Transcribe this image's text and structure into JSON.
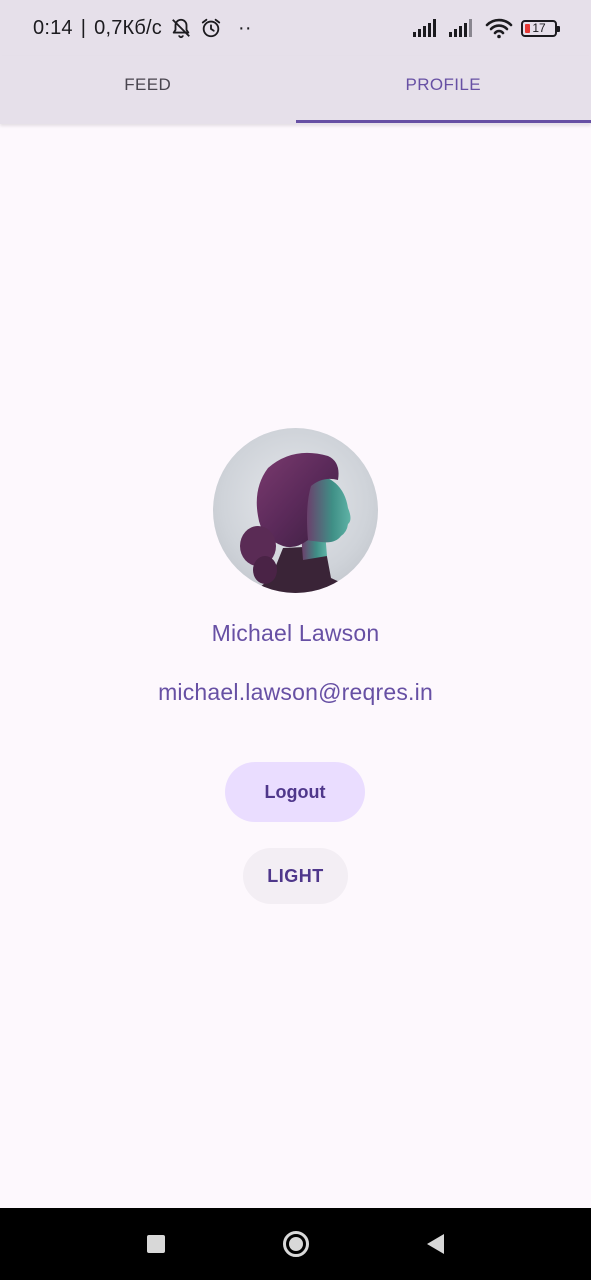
{
  "status_bar": {
    "time": "0:14",
    "separator": "|",
    "speed": "0,7Кб/с",
    "more": "··",
    "battery_level": "17",
    "icons": [
      "bell-off-icon",
      "alarm-icon",
      "signal-icon",
      "signal-icon",
      "wifi-icon",
      "battery-icon"
    ]
  },
  "tabs": [
    {
      "label": "FEED",
      "active": false
    },
    {
      "label": "PROFILE",
      "active": true
    }
  ],
  "profile": {
    "name": "Michael Lawson",
    "email": "michael.lawson@reqres.in"
  },
  "buttons": {
    "logout": "Logout",
    "theme": "LIGHT"
  },
  "colors": {
    "primary": "#6750a4",
    "tab_bar_bg": "#e6e0ea",
    "page_bg": "#fdf8fd",
    "logout_bg": "#eaddff",
    "theme_bg": "#f3eef4",
    "battery_low": "#e53935"
  }
}
